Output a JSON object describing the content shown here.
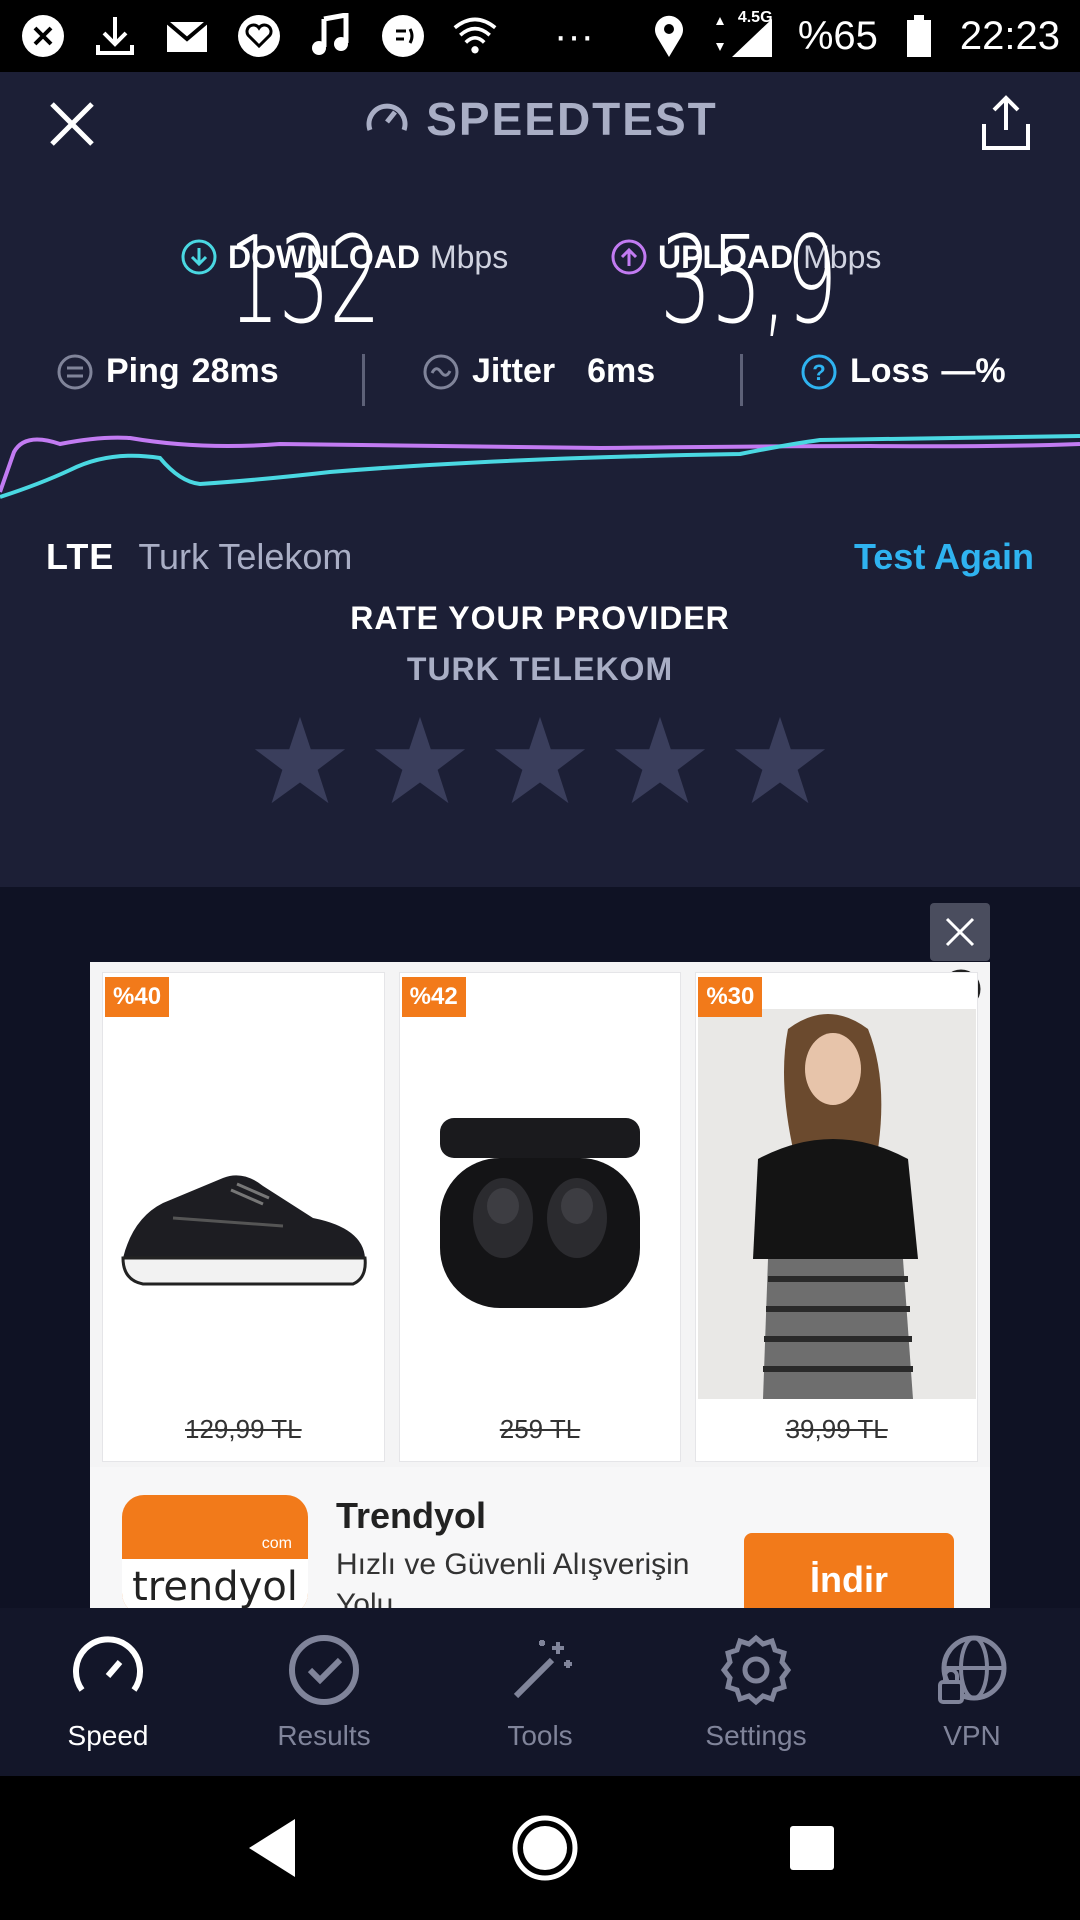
{
  "status_bar": {
    "battery_text": "%65",
    "network_badge": "4.5G",
    "time": "22:23",
    "overflow": "···"
  },
  "header": {
    "title": "SPEEDTEST"
  },
  "metrics": {
    "download": {
      "label": "DOWNLOAD",
      "unit": "Mbps",
      "value": "132",
      "color": "#4ad8e2"
    },
    "upload": {
      "label": "UPLOAD",
      "unit": "Mbps",
      "value": "35,9",
      "color": "#c27bf2"
    }
  },
  "stats": {
    "ping": {
      "label": "Ping",
      "value": "28ms"
    },
    "jitter": {
      "label": "Jitter",
      "value": "6ms"
    },
    "loss": {
      "label": "Loss",
      "value": "—%"
    }
  },
  "connection": {
    "type": "LTE",
    "provider": "Turk Telekom",
    "test_again": "Test Again"
  },
  "rating": {
    "title": "RATE YOUR PROVIDER",
    "provider": "TURK TELEKOM",
    "stars_filled": 0,
    "stars_total": 5
  },
  "ad": {
    "products": [
      {
        "badge": "%40",
        "price": "129,99 TL",
        "image": "black-sneaker"
      },
      {
        "badge": "%42",
        "price": "259 TL",
        "image": "wireless-earbuds"
      },
      {
        "badge": "%30",
        "price": "39,99 TL",
        "image": "woman-outfit"
      }
    ],
    "brand_logo_text": "trendyol",
    "brand_logo_sub": "com",
    "brand_name": "Trendyol",
    "brand_desc": "Hızlı ve Güvenli Alışverişin Yolu",
    "cta": "İndir"
  },
  "tabs": [
    {
      "label": "Speed",
      "icon": "speed-gauge-icon",
      "active": true
    },
    {
      "label": "Results",
      "icon": "results-check-icon",
      "active": false
    },
    {
      "label": "Tools",
      "icon": "tools-wand-icon",
      "active": false
    },
    {
      "label": "Settings",
      "icon": "settings-gear-icon",
      "active": false
    },
    {
      "label": "VPN",
      "icon": "vpn-globe-lock-icon",
      "active": false
    }
  ],
  "colors": {
    "accent_blue": "#2fb3f0",
    "brand_orange": "#f27a1a",
    "app_bg": "#1c1f36"
  }
}
